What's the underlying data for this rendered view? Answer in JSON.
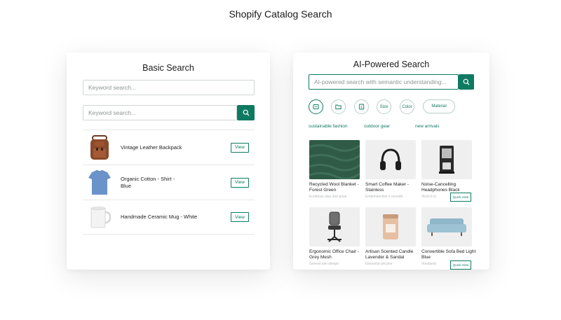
{
  "page": {
    "title": "Shopify Catalog Search"
  },
  "basic": {
    "title": "Basic Search",
    "input1_placeholder": "Keyword search...",
    "input2_placeholder": "Keyword search...",
    "results": [
      {
        "label": "Vintage Leather Backpack",
        "button": "View"
      },
      {
        "label": "Organic Cotton - Shirt - Blue",
        "button": "View"
      },
      {
        "label": "Handmade Ceramic Mug - White",
        "button": "View"
      }
    ]
  },
  "ai": {
    "title": "AI-Powered Search",
    "placeholder": "AI-powered search with semantic understanding...",
    "filters": {
      "size": "Size",
      "color": "Color",
      "material": "Material"
    },
    "suggestions": [
      "sustainable fashion",
      "outdoor gear",
      "new arrivals"
    ],
    "products": [
      {
        "name": "Recycled Wool Blanket - Forest Green",
        "sub": "Ecotricas stau stor pose"
      },
      {
        "name": "Smart Coffee Maker - Stainless",
        "sub": "Embonsectise o ecoode"
      },
      {
        "name": "Noise-Cancelling Headphones Black",
        "sub": "Vicid d oc",
        "quick": "Quick View"
      },
      {
        "name": "Ergonomic Office Chair - Grey Mesh",
        "sub": "Greeral wei aleope"
      },
      {
        "name": "Artisan Scented Candle Lavender & Sandal",
        "sub": "Elesuntal ant pee"
      },
      {
        "name": "Convertible Sofa Bed Light Blue",
        "sub": "Vourlaeid",
        "quick": "Quick View"
      }
    ]
  },
  "colors": {
    "accent": "#0e7a61"
  }
}
